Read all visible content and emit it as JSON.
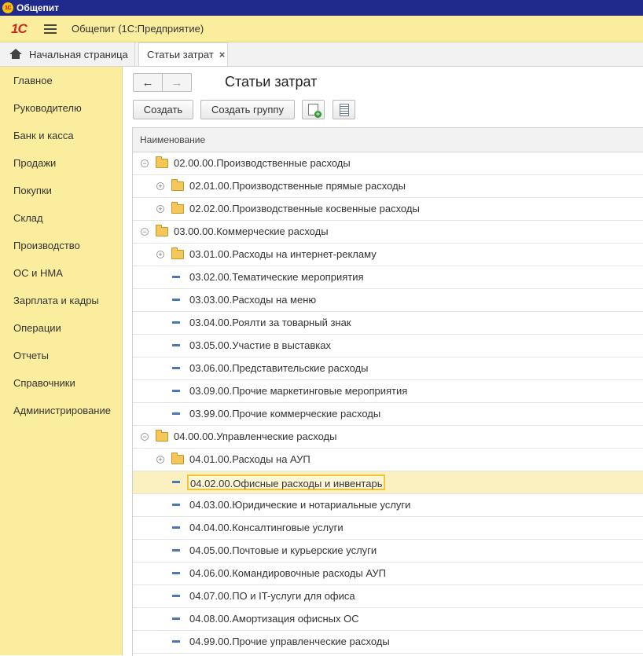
{
  "window": {
    "title": "Общепит",
    "logo_text": "1С"
  },
  "appbar": {
    "brand": "1С",
    "title": "Общепит  (1С:Предприятие)"
  },
  "tabs": {
    "home": "Начальная страница",
    "active": "Статьи затрат",
    "close": "×"
  },
  "sidebar": {
    "items": [
      "Главное",
      "Руководителю",
      "Банк и касса",
      "Продажи",
      "Покупки",
      "Склад",
      "Производство",
      "ОС и НМА",
      "Зарплата и кадры",
      "Операции",
      "Отчеты",
      "Справочники",
      "Администрирование"
    ]
  },
  "form": {
    "title": "Статьи затрат",
    "back": "←",
    "forward": "→",
    "create": "Создать",
    "create_group": "Создать группу"
  },
  "table": {
    "header": "Наименование",
    "rows": [
      {
        "level": 0,
        "type": "group",
        "state": "expanded",
        "name": "02.00.00.Производственные расходы"
      },
      {
        "level": 1,
        "type": "group",
        "state": "collapsed",
        "name": "02.01.00.Производственные прямые расходы"
      },
      {
        "level": 1,
        "type": "group",
        "state": "collapsed",
        "name": "02.02.00.Производственные косвенные расходы"
      },
      {
        "level": 0,
        "type": "group",
        "state": "expanded",
        "name": "03.00.00.Коммерческие расходы"
      },
      {
        "level": 1,
        "type": "group",
        "state": "collapsed",
        "name": "03.01.00.Расходы на интернет-рекламу"
      },
      {
        "level": 1,
        "type": "item",
        "name": "03.02.00.Тематические мероприятия"
      },
      {
        "level": 1,
        "type": "item",
        "name": "03.03.00.Расходы на меню"
      },
      {
        "level": 1,
        "type": "item",
        "name": "03.04.00.Роялти за товарный знак"
      },
      {
        "level": 1,
        "type": "item",
        "name": "03.05.00.Участие в выставках"
      },
      {
        "level": 1,
        "type": "item",
        "name": "03.06.00.Представительские расходы"
      },
      {
        "level": 1,
        "type": "item",
        "name": "03.09.00.Прочие маркетинговые мероприятия"
      },
      {
        "level": 1,
        "type": "item",
        "name": "03.99.00.Прочие коммерческие расходы"
      },
      {
        "level": 0,
        "type": "group",
        "state": "expanded",
        "name": "04.00.00.Управленческие расходы"
      },
      {
        "level": 1,
        "type": "group",
        "state": "collapsed",
        "name": "04.01.00.Расходы на АУП"
      },
      {
        "level": 1,
        "type": "item",
        "selected": true,
        "name": "04.02.00.Офисные расходы и инвентарь"
      },
      {
        "level": 1,
        "type": "item",
        "name": "04.03.00.Юридические и нотариальные услуги"
      },
      {
        "level": 1,
        "type": "item",
        "name": "04.04.00.Консалтинговые услуги"
      },
      {
        "level": 1,
        "type": "item",
        "name": "04.05.00.Почтовые и курьерские услуги"
      },
      {
        "level": 1,
        "type": "item",
        "name": "04.06.00.Командировочные расходы АУП"
      },
      {
        "level": 1,
        "type": "item",
        "name": "04.07.00.ПО и IT-услуги для офиса"
      },
      {
        "level": 1,
        "type": "item",
        "name": "04.08.00.Амортизация офисных ОС"
      },
      {
        "level": 1,
        "type": "item",
        "name": "04.99.00.Прочие управленческие расходы"
      }
    ]
  },
  "colors": {
    "accent_yellow": "#fbed9e",
    "selection": "#f0c43c",
    "title_bar": "#1f2a8c"
  }
}
